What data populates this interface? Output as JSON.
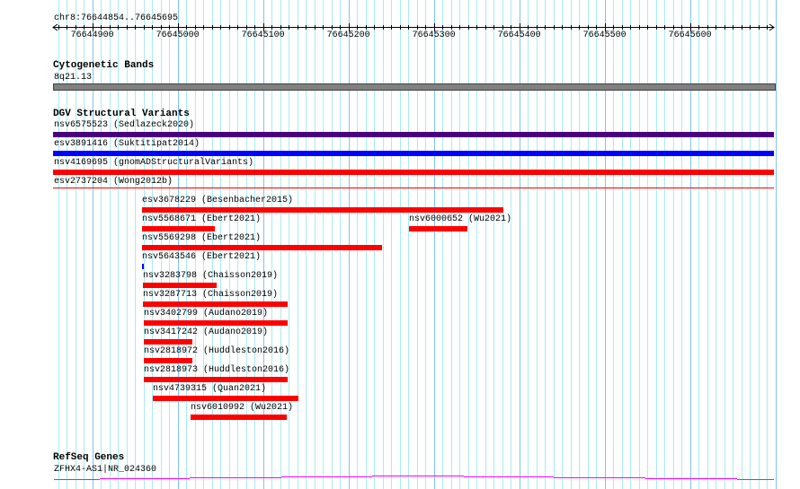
{
  "view": {
    "chrom": "chr8",
    "start": 76644854,
    "end": 76645695,
    "location_label": "chr8:76644854..76645695"
  },
  "ruler": {
    "tick_labels": [
      "76644900",
      "76645000",
      "76645100",
      "76645200",
      "76645300",
      "76645400",
      "76645500",
      "76645600"
    ]
  },
  "cytoband": {
    "title": "Cytogenetic Bands",
    "band": "8q21.13",
    "color": "#808080"
  },
  "dgv": {
    "title": "DGV Structural Variants",
    "full_span": [
      {
        "label": "nsv6575523 (Sedlazeck2020)",
        "color": "#4b0082"
      },
      {
        "label": "esv3891416 (Suktitipat2014)",
        "color": "#0000ff"
      },
      {
        "label": "nsv4169695 (gnomADStructuralVariants)",
        "color": "#ff0000"
      },
      {
        "label": "esv2737204 (Wong2012b)",
        "color": "#ff0000"
      }
    ],
    "lanes": [
      [
        {
          "label": "esv3678229 (Besenbacher2015)",
          "start": 76644958,
          "end": 76645381,
          "color": "#ff0000"
        }
      ],
      [
        {
          "label": "nsv5568671 (Ebert2021)",
          "start": 76644958,
          "end": 76645043,
          "color": "#ff0000"
        },
        {
          "label": "nsv6000652 (Wu2021)",
          "start": 76645271,
          "end": 76645339,
          "color": "#ff0000"
        }
      ],
      [
        {
          "label": "nsv5569298 (Ebert2021)",
          "start": 76644958,
          "end": 76645239,
          "color": "#ff0000"
        }
      ],
      [
        {
          "label": "nsv5643546 (Ebert2021)",
          "start": 76644958,
          "end": 76644960,
          "color": "#0000ff"
        }
      ],
      [
        {
          "label": "nsv3283798 (Chaisson2019)",
          "start": 76644959,
          "end": 76645046,
          "color": "#ff0000"
        }
      ],
      [
        {
          "label": "nsv3287713 (Chaisson2019)",
          "start": 76644959,
          "end": 76645129,
          "color": "#ff0000"
        }
      ],
      [
        {
          "label": "nsv3402799 (Audano2019)",
          "start": 76644960,
          "end": 76645129,
          "color": "#ff0000"
        }
      ],
      [
        {
          "label": "nsv3417242 (Audano2019)",
          "start": 76644960,
          "end": 76645017,
          "color": "#ff0000"
        }
      ],
      [
        {
          "label": "nsv2818972 (Huddleston2016)",
          "start": 76644960,
          "end": 76645017,
          "color": "#ff0000"
        }
      ],
      [
        {
          "label": "nsv2818973 (Huddleston2016)",
          "start": 76644960,
          "end": 76645129,
          "color": "#ff0000"
        }
      ],
      [
        {
          "label": "nsv4739315 (Quan2021)",
          "start": 76644971,
          "end": 76645141,
          "color": "#ff0000"
        }
      ],
      [
        {
          "label": "nsv6010992 (Wu2021)",
          "start": 76645015,
          "end": 76645128,
          "color": "#ff0000"
        }
      ]
    ]
  },
  "refseq": {
    "title": "RefSeq Genes",
    "gene": "ZFHX4-AS1|NR_024360",
    "color": "#ff00ff"
  }
}
